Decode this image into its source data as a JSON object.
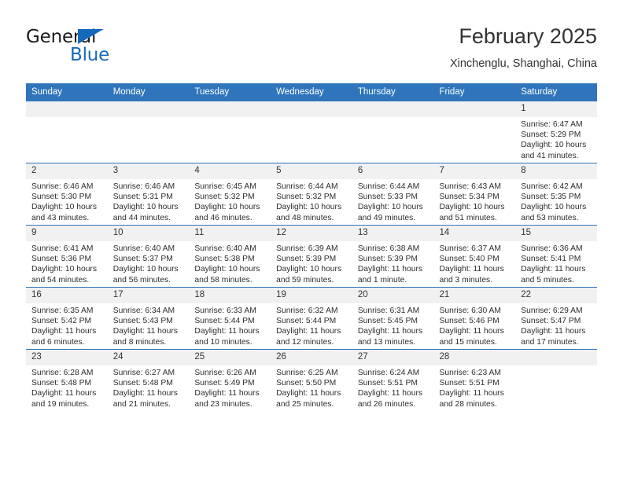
{
  "brand": {
    "name_part1": "General",
    "name_part2": "Blue",
    "accent_color": "#1569ba"
  },
  "header": {
    "title": "February 2025",
    "subtitle": "Xinchenglu, Shanghai, China"
  },
  "theme": {
    "header_row_color": "#2e75bb",
    "daynum_band_color": "#f1f1f1",
    "text_color": "#2d2d2d"
  },
  "weekday_headers": [
    "Sunday",
    "Monday",
    "Tuesday",
    "Wednesday",
    "Thursday",
    "Friday",
    "Saturday"
  ],
  "weeks": [
    [
      {
        "day": "",
        "empty": true
      },
      {
        "day": "",
        "empty": true
      },
      {
        "day": "",
        "empty": true
      },
      {
        "day": "",
        "empty": true
      },
      {
        "day": "",
        "empty": true
      },
      {
        "day": "",
        "empty": true
      },
      {
        "day": "1",
        "sunrise": "Sunrise: 6:47 AM",
        "sunset": "Sunset: 5:29 PM",
        "daylight": "Daylight: 10 hours and 41 minutes."
      }
    ],
    [
      {
        "day": "2",
        "sunrise": "Sunrise: 6:46 AM",
        "sunset": "Sunset: 5:30 PM",
        "daylight": "Daylight: 10 hours and 43 minutes."
      },
      {
        "day": "3",
        "sunrise": "Sunrise: 6:46 AM",
        "sunset": "Sunset: 5:31 PM",
        "daylight": "Daylight: 10 hours and 44 minutes."
      },
      {
        "day": "4",
        "sunrise": "Sunrise: 6:45 AM",
        "sunset": "Sunset: 5:32 PM",
        "daylight": "Daylight: 10 hours and 46 minutes."
      },
      {
        "day": "5",
        "sunrise": "Sunrise: 6:44 AM",
        "sunset": "Sunset: 5:32 PM",
        "daylight": "Daylight: 10 hours and 48 minutes."
      },
      {
        "day": "6",
        "sunrise": "Sunrise: 6:44 AM",
        "sunset": "Sunset: 5:33 PM",
        "daylight": "Daylight: 10 hours and 49 minutes."
      },
      {
        "day": "7",
        "sunrise": "Sunrise: 6:43 AM",
        "sunset": "Sunset: 5:34 PM",
        "daylight": "Daylight: 10 hours and 51 minutes."
      },
      {
        "day": "8",
        "sunrise": "Sunrise: 6:42 AM",
        "sunset": "Sunset: 5:35 PM",
        "daylight": "Daylight: 10 hours and 53 minutes."
      }
    ],
    [
      {
        "day": "9",
        "sunrise": "Sunrise: 6:41 AM",
        "sunset": "Sunset: 5:36 PM",
        "daylight": "Daylight: 10 hours and 54 minutes."
      },
      {
        "day": "10",
        "sunrise": "Sunrise: 6:40 AM",
        "sunset": "Sunset: 5:37 PM",
        "daylight": "Daylight: 10 hours and 56 minutes."
      },
      {
        "day": "11",
        "sunrise": "Sunrise: 6:40 AM",
        "sunset": "Sunset: 5:38 PM",
        "daylight": "Daylight: 10 hours and 58 minutes."
      },
      {
        "day": "12",
        "sunrise": "Sunrise: 6:39 AM",
        "sunset": "Sunset: 5:39 PM",
        "daylight": "Daylight: 10 hours and 59 minutes."
      },
      {
        "day": "13",
        "sunrise": "Sunrise: 6:38 AM",
        "sunset": "Sunset: 5:39 PM",
        "daylight": "Daylight: 11 hours and 1 minute."
      },
      {
        "day": "14",
        "sunrise": "Sunrise: 6:37 AM",
        "sunset": "Sunset: 5:40 PM",
        "daylight": "Daylight: 11 hours and 3 minutes."
      },
      {
        "day": "15",
        "sunrise": "Sunrise: 6:36 AM",
        "sunset": "Sunset: 5:41 PM",
        "daylight": "Daylight: 11 hours and 5 minutes."
      }
    ],
    [
      {
        "day": "16",
        "sunrise": "Sunrise: 6:35 AM",
        "sunset": "Sunset: 5:42 PM",
        "daylight": "Daylight: 11 hours and 6 minutes."
      },
      {
        "day": "17",
        "sunrise": "Sunrise: 6:34 AM",
        "sunset": "Sunset: 5:43 PM",
        "daylight": "Daylight: 11 hours and 8 minutes."
      },
      {
        "day": "18",
        "sunrise": "Sunrise: 6:33 AM",
        "sunset": "Sunset: 5:44 PM",
        "daylight": "Daylight: 11 hours and 10 minutes."
      },
      {
        "day": "19",
        "sunrise": "Sunrise: 6:32 AM",
        "sunset": "Sunset: 5:44 PM",
        "daylight": "Daylight: 11 hours and 12 minutes."
      },
      {
        "day": "20",
        "sunrise": "Sunrise: 6:31 AM",
        "sunset": "Sunset: 5:45 PM",
        "daylight": "Daylight: 11 hours and 13 minutes."
      },
      {
        "day": "21",
        "sunrise": "Sunrise: 6:30 AM",
        "sunset": "Sunset: 5:46 PM",
        "daylight": "Daylight: 11 hours and 15 minutes."
      },
      {
        "day": "22",
        "sunrise": "Sunrise: 6:29 AM",
        "sunset": "Sunset: 5:47 PM",
        "daylight": "Daylight: 11 hours and 17 minutes."
      }
    ],
    [
      {
        "day": "23",
        "sunrise": "Sunrise: 6:28 AM",
        "sunset": "Sunset: 5:48 PM",
        "daylight": "Daylight: 11 hours and 19 minutes."
      },
      {
        "day": "24",
        "sunrise": "Sunrise: 6:27 AM",
        "sunset": "Sunset: 5:48 PM",
        "daylight": "Daylight: 11 hours and 21 minutes."
      },
      {
        "day": "25",
        "sunrise": "Sunrise: 6:26 AM",
        "sunset": "Sunset: 5:49 PM",
        "daylight": "Daylight: 11 hours and 23 minutes."
      },
      {
        "day": "26",
        "sunrise": "Sunrise: 6:25 AM",
        "sunset": "Sunset: 5:50 PM",
        "daylight": "Daylight: 11 hours and 25 minutes."
      },
      {
        "day": "27",
        "sunrise": "Sunrise: 6:24 AM",
        "sunset": "Sunset: 5:51 PM",
        "daylight": "Daylight: 11 hours and 26 minutes."
      },
      {
        "day": "28",
        "sunrise": "Sunrise: 6:23 AM",
        "sunset": "Sunset: 5:51 PM",
        "daylight": "Daylight: 11 hours and 28 minutes."
      },
      {
        "day": "",
        "empty": true
      }
    ]
  ]
}
